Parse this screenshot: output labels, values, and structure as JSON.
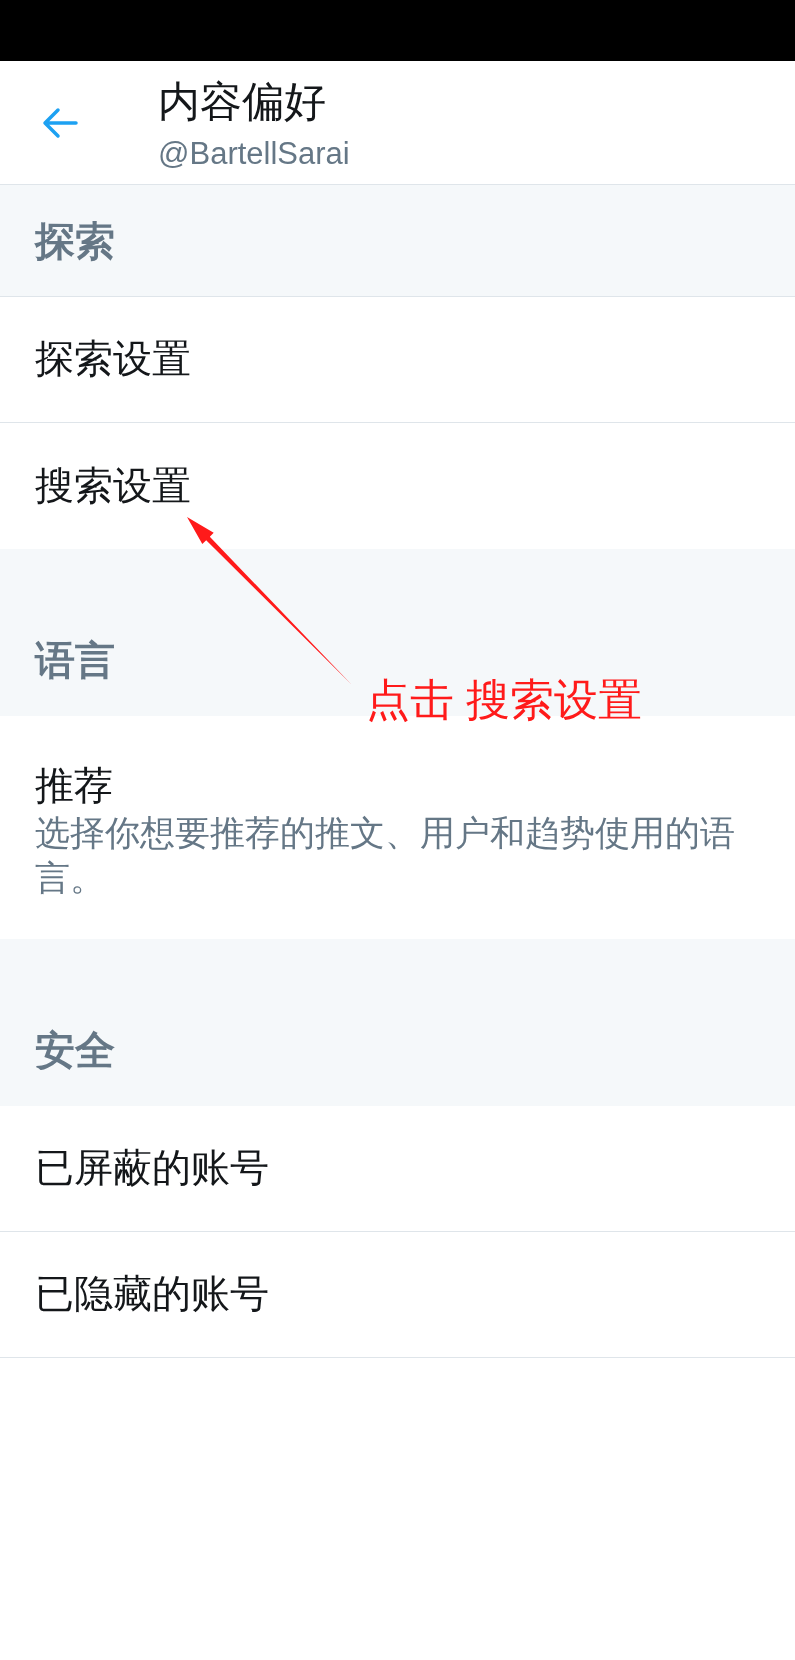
{
  "header": {
    "title": "内容偏好",
    "handle": "@BartellSarai"
  },
  "sections": [
    {
      "title": "探索",
      "items": [
        {
          "label": "探索设置"
        },
        {
          "label": "搜索设置"
        }
      ]
    },
    {
      "title": "语言",
      "items": [
        {
          "label": "推荐",
          "description": "选择你想要推荐的推文、用户和趋势使用的语言。"
        }
      ]
    },
    {
      "title": "安全",
      "items": [
        {
          "label": "已屏蔽的账号"
        },
        {
          "label": "已隐藏的账号"
        }
      ]
    }
  ],
  "annotation": {
    "text": "点击 搜索设置"
  }
}
